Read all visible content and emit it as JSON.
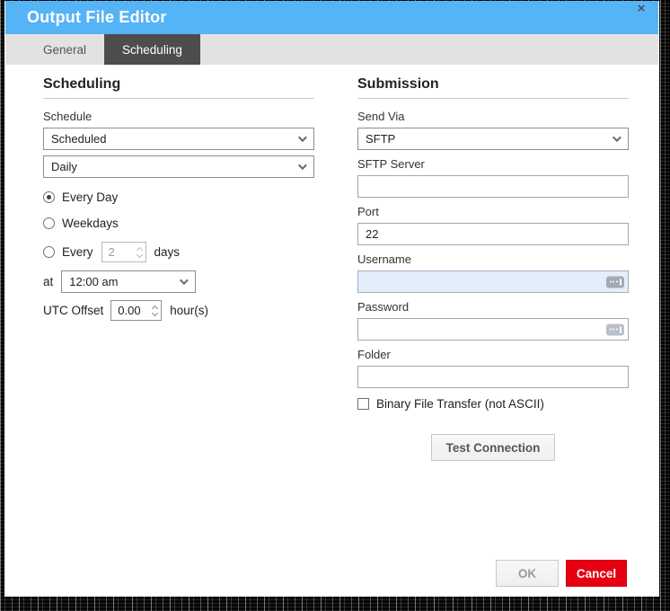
{
  "window": {
    "title": "Output File Editor",
    "close_icon": "×"
  },
  "tabs": {
    "general": "General",
    "scheduling": "Scheduling",
    "active_tab": "Scheduling"
  },
  "scheduling": {
    "heading": "Scheduling",
    "schedule_label": "Schedule",
    "schedule_value": "Scheduled",
    "frequency_value": "Daily",
    "radio_every_day": "Every Day",
    "radio_weekdays": "Weekdays",
    "radio_every": "Every",
    "selected_radio": "Every Day",
    "every_days_value": "2",
    "days_suffix": "days",
    "at_label": "at",
    "time_value": "12:00 am",
    "utc_offset_label": "UTC Offset",
    "utc_offset_value": "0.00",
    "utc_offset_suffix": "hour(s)"
  },
  "submission": {
    "heading": "Submission",
    "send_via_label": "Send Via",
    "send_via_value": "SFTP",
    "sftp_server_label": "SFTP Server",
    "sftp_server_value": "",
    "port_label": "Port",
    "port_value": "22",
    "username_label": "Username",
    "username_value": "",
    "password_label": "Password",
    "password_value": "",
    "folder_label": "Folder",
    "folder_value": "",
    "binary_checkbox_label": "Binary File Transfer (not ASCII)",
    "binary_checked": false,
    "test_connection_label": "Test Connection"
  },
  "footer": {
    "ok_label": "OK",
    "cancel_label": "Cancel"
  },
  "colors": {
    "titlebar_blue": "#55b4f6",
    "active_tab_gray": "#4d4d4d",
    "cancel_red": "#e60012",
    "username_highlight": "#e4eefb"
  }
}
